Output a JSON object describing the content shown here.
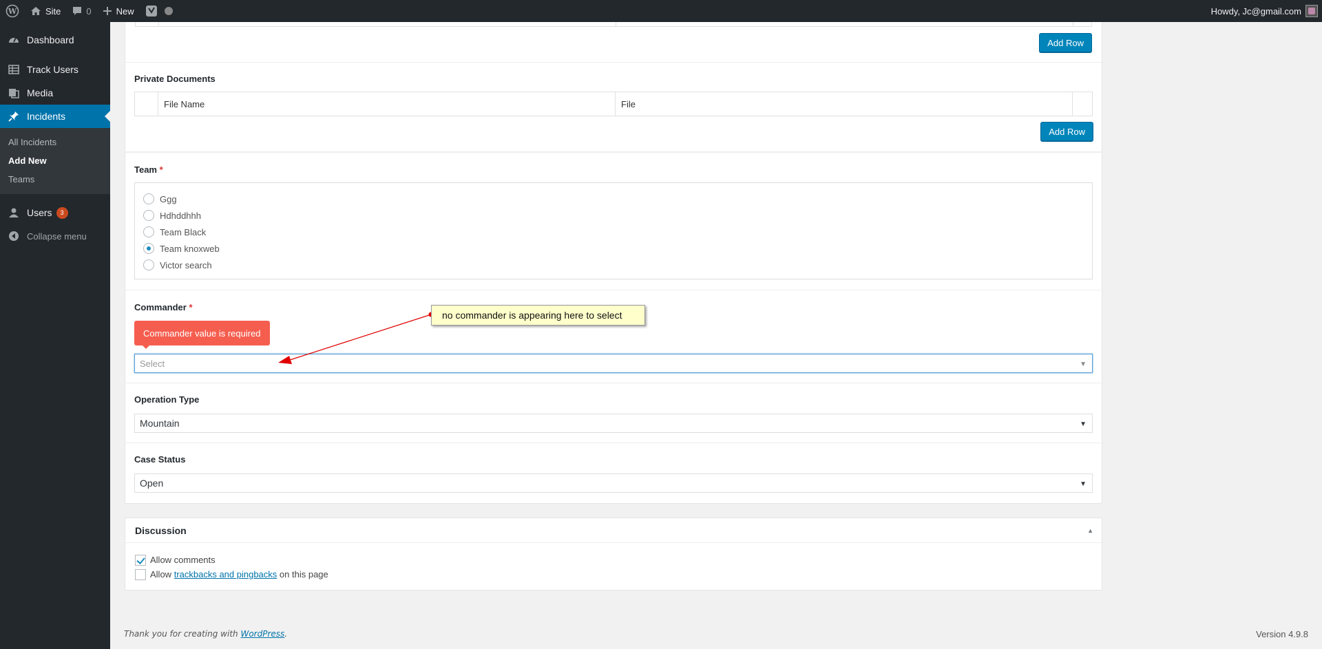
{
  "adminbar": {
    "site": "Site",
    "comments_count": "0",
    "new_label": "New",
    "howdy": "Howdy, Jc@gmail.com"
  },
  "sidebar": {
    "items": [
      {
        "label": "Dashboard",
        "icon": "dashboard-icon"
      },
      {
        "label": "Track Users",
        "icon": "table-icon"
      },
      {
        "label": "Media",
        "icon": "media-icon"
      },
      {
        "label": "Incidents",
        "icon": "pin-icon"
      }
    ],
    "submenu": [
      "All Incidents",
      "Add New",
      "Teams"
    ],
    "users_label": "Users",
    "users_badge": "3",
    "collapse_label": "Collapse menu"
  },
  "form": {
    "add_row_label": "Add Row",
    "private_documents": {
      "label": "Private Documents",
      "columns": [
        "File Name",
        "File"
      ]
    },
    "team": {
      "label": "Team",
      "required": "*",
      "options": [
        "Ggg",
        "Hdhddhhh",
        "Team Black",
        "Team knoxweb",
        "Victor search"
      ],
      "selected": "Team knoxweb"
    },
    "commander": {
      "label": "Commander",
      "required": "*",
      "error": "Commander value is required",
      "placeholder": "Select"
    },
    "operation_type": {
      "label": "Operation Type",
      "value": "Mountain"
    },
    "case_status": {
      "label": "Case Status",
      "value": "Open"
    }
  },
  "discussion": {
    "title": "Discussion",
    "allow_comments": "Allow comments",
    "allow_prefix": "Allow",
    "trackbacks_link": "trackbacks and pingbacks",
    "allow_suffix": "on this page"
  },
  "footer": {
    "thanks_prefix": "Thank you for creating with",
    "wordpress_link": "WordPress",
    "thanks_suffix": ".",
    "version": "Version 4.9.8"
  },
  "annotation": {
    "text": "no commander is appearing here to select",
    "color": "#e00000"
  },
  "colors": {
    "admin_dark": "#23282d",
    "primary_blue": "#0085ba",
    "current_menu": "#0073aa",
    "error_red": "#f55e4f",
    "badge": "#ca4a1f"
  }
}
